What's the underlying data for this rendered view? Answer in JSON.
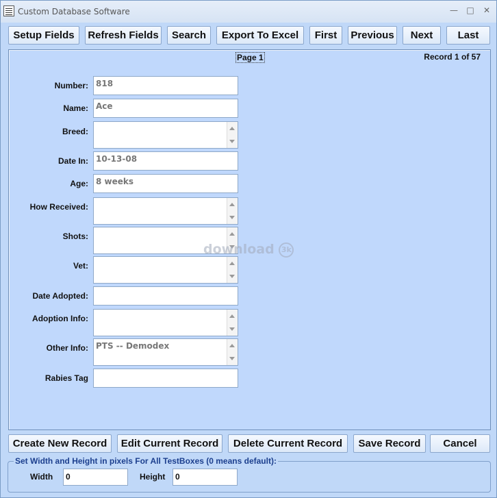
{
  "window": {
    "title": "Custom Database Software",
    "minimize": "—",
    "maximize": "□",
    "close": "✕"
  },
  "toolbar": {
    "setup_fields": "Setup Fields",
    "refresh_fields": "Refresh Fields",
    "search": "Search",
    "export_excel": "Export To Excel",
    "first": "First",
    "previous": "Previous",
    "next": "Next",
    "last": "Last"
  },
  "record": {
    "page": "Page 1",
    "position": "Record 1 of 57"
  },
  "fields": {
    "number": {
      "label": "Number:",
      "value": "818"
    },
    "name": {
      "label": "Name:",
      "value": "Ace"
    },
    "breed": {
      "label": "Breed:",
      "value": ""
    },
    "date_in": {
      "label": "Date In:",
      "value": "10-13-08"
    },
    "age": {
      "label": "Age:",
      "value": "8 weeks"
    },
    "how_received": {
      "label": "How Received:",
      "value": ""
    },
    "shots": {
      "label": "Shots:",
      "value": ""
    },
    "vet": {
      "label": "Vet:",
      "value": ""
    },
    "date_adopted": {
      "label": "Date Adopted:",
      "value": ""
    },
    "adoption_info": {
      "label": "Adoption Info:",
      "value": ""
    },
    "other_info": {
      "label": "Other Info:",
      "value": "PTS -- Demodex"
    },
    "rabies_tag": {
      "label": "Rabies Tag",
      "value": ""
    }
  },
  "watermark": {
    "text": "download",
    "badge": "3k"
  },
  "actions": {
    "create": "Create New Record",
    "edit": "Edit Current Record",
    "delete": "Delete Current Record",
    "save": "Save Record",
    "cancel": "Cancel"
  },
  "sizing": {
    "title": "Set Width and Height in pixels For All TestBoxes (0 means default):",
    "width_label": "Width",
    "width_value": "0",
    "height_label": "Height",
    "height_value": "0"
  }
}
